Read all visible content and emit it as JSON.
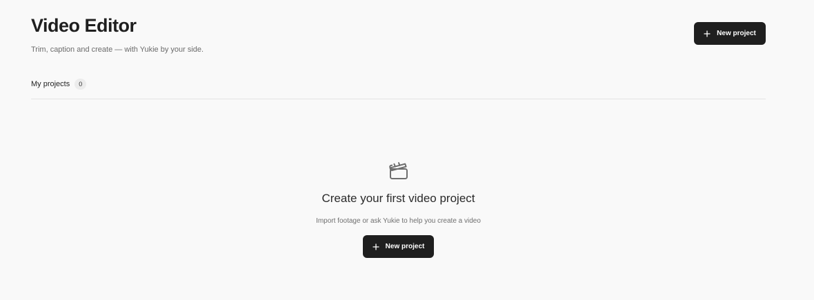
{
  "header": {
    "title": "Video Editor",
    "subtitle": "Trim, caption and create — with Yukie by your side.",
    "new_project_label": "New project"
  },
  "tabs": {
    "my_projects_label": "My projects",
    "my_projects_count": "0"
  },
  "empty_state": {
    "icon": "clapperboard-icon",
    "title": "Create your first video project",
    "description": "Import footage or ask Yukie to help you create a video",
    "button_label": "New project"
  },
  "colors": {
    "background": "#f9f9f9",
    "button": "#1f1f1f",
    "button_text": "#ffffff"
  }
}
